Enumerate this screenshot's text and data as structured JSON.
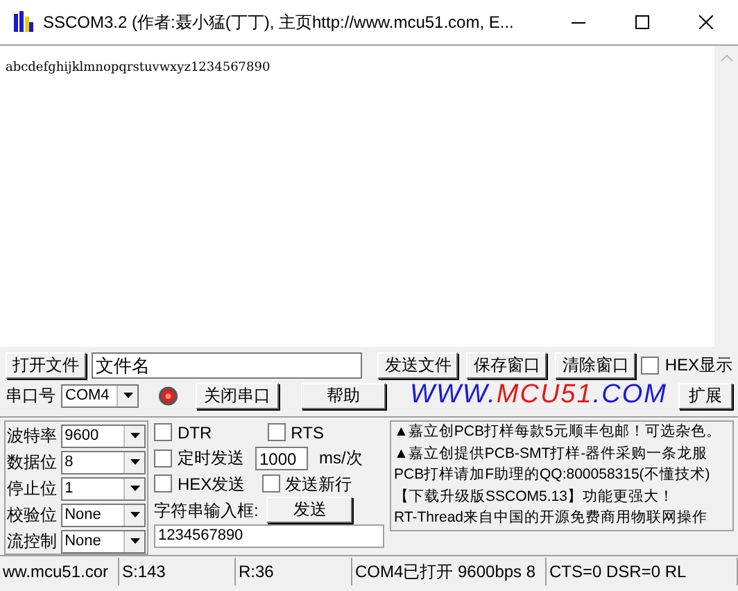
{
  "window": {
    "title": "SSCOM3.2 (作者:聂小猛(丁丁), 主页http://www.mcu51.com,  E..."
  },
  "receive_text": "abcdefghijklmnopqrstuvwxyz1234567890",
  "file_row": {
    "open_button": "打开文件",
    "file_field": "文件名",
    "buttons": [
      "发送文件",
      "保存窗口",
      "清除窗口"
    ],
    "hex_display": {
      "label": "HEX显示",
      "checked": false
    }
  },
  "port_row": {
    "label": "串口号",
    "port": "COM4",
    "port_open": true,
    "close_button": "关闭串口",
    "help_button": "帮助",
    "logo": [
      {
        "text": "WWW.",
        "color": "#1a1ad0"
      },
      {
        "text": "MCU51",
        "color": "#e01818"
      },
      {
        "text": ".COM",
        "color": "#1a1ad0"
      }
    ],
    "expand_button": "扩展"
  },
  "settings": [
    {
      "label": "波特率",
      "value": "9600"
    },
    {
      "label": "数据位",
      "value": "8"
    },
    {
      "label": "停止位",
      "value": "1"
    },
    {
      "label": "校验位",
      "value": "None"
    },
    {
      "label": "流控制",
      "value": "None"
    }
  ],
  "send": {
    "dtr": {
      "label": "DTR",
      "checked": false
    },
    "rts": {
      "label": "RTS",
      "checked": false
    },
    "timed": {
      "label": "定时发送",
      "checked": false
    },
    "interval": "1000",
    "interval_unit": "ms/次",
    "hex_send": {
      "label": "HEX发送",
      "checked": false
    },
    "newline": {
      "label": "发送新行",
      "checked": false
    },
    "input_label": "字符串输入框:",
    "send_button": "发送",
    "input_value": "1234567890"
  },
  "ads": [
    "▲嘉立创PCB打样每款5元顺丰包邮！可选杂色。",
    "▲嘉立创提供PCB-SMT打样-器件采购一条龙服",
    "PCB打样请加F助理的QQ:800058315(不懂技术)",
    "【下载升级版SSCOM5.13】功能更强大！",
    "RT-Thread来自中国的开源免费商用物联网操作"
  ],
  "status_bar": [
    "ww.mcu51.cor",
    "S:143",
    "R:36",
    "COM4已打开  9600bps  8",
    "CTS=0 DSR=0 RL"
  ]
}
